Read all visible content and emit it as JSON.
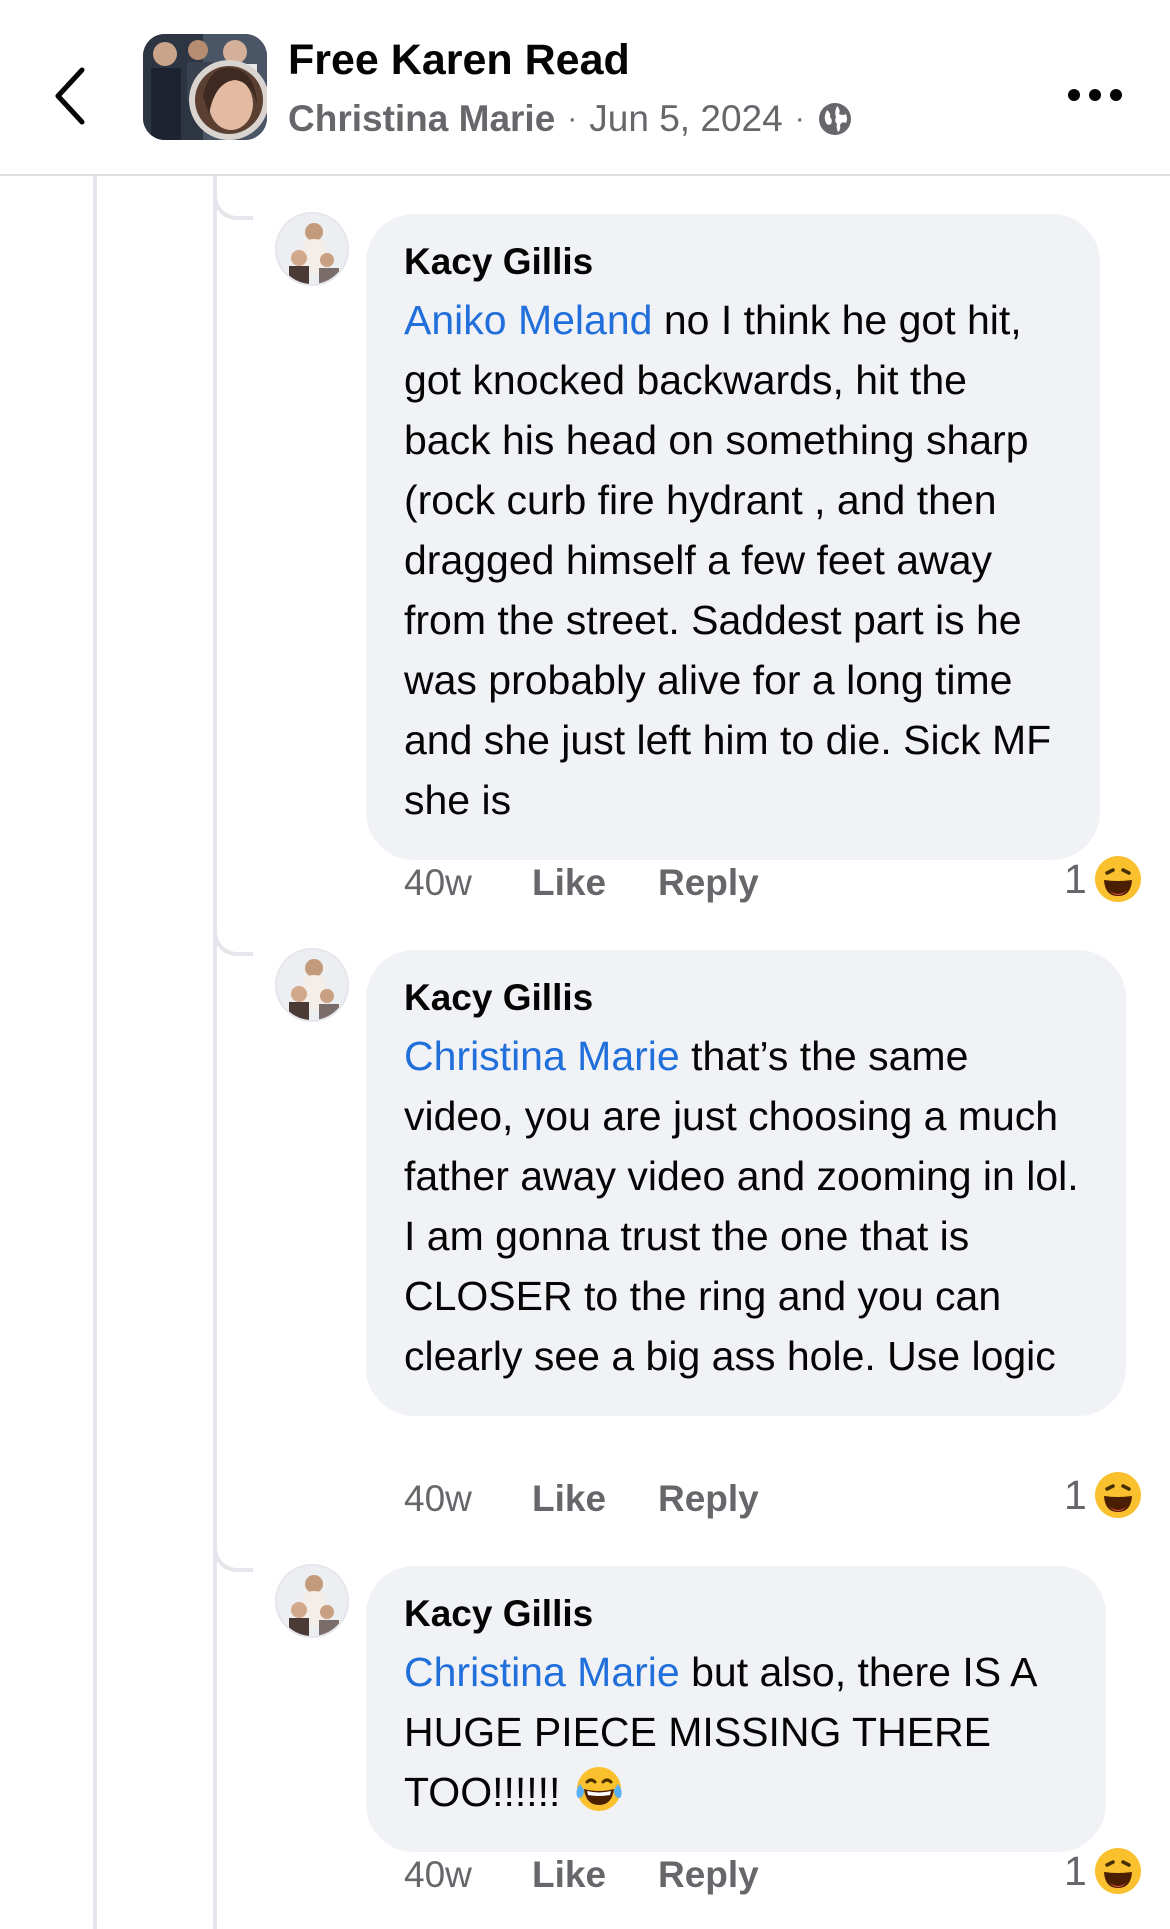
{
  "header": {
    "back_icon": "chevron-left-icon",
    "title": "Free Karen Read",
    "author": "Christina Marie",
    "separator": "·",
    "date": "Jun 5, 2024",
    "privacy_icon": "globe-icon",
    "more_icon": "more-horizontal-icon"
  },
  "comments": [
    {
      "name": "Kacy Gillis",
      "mention": "Aniko Meland",
      "text": " no I think he got hit, got knocked backwards, hit the back his head on something sharp (rock curb fire hydrant , and then dragged himself a few feet away from the street. Saddest part is he was probably alive for a long time and she just left him to die. Sick MF she is",
      "time": "40w",
      "like": "Like",
      "reply": "Reply",
      "reaction_count": "1",
      "reaction_icon": "haha-reaction-icon"
    },
    {
      "name": "Kacy Gillis",
      "mention": "Christina Marie",
      "text": " that’s the same video, you are just choosing a much father away video and zooming in lol. I am gonna trust the one that is CLOSER to the ring and you can clearly see a big ass hole. Use logic",
      "time": "40w",
      "like": "Like",
      "reply": "Reply",
      "reaction_count": "1",
      "reaction_icon": "haha-reaction-icon"
    },
    {
      "name": "Kacy Gillis",
      "mention": "Christina Marie",
      "text": " but also, there IS A HUGE PIECE MISSING THERE TOO!!!!!! ",
      "inline_emoji": "laughing-tears-emoji-icon",
      "time": "40w",
      "like": "Like",
      "reply": "Reply",
      "reaction_count": "1",
      "reaction_icon": "haha-reaction-icon"
    }
  ],
  "colors": {
    "mention": "#216fdb",
    "bubble": "#f0f2f5",
    "secondary_text": "#65676b",
    "reaction_yellow": "#fbc02d"
  }
}
